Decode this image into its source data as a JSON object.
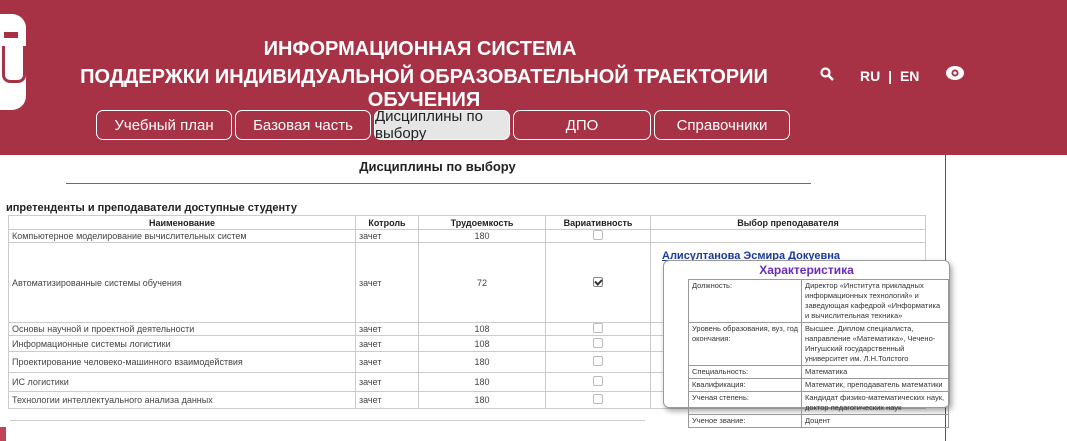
{
  "header": {
    "title_line1": "ИНФОРМАЦИОННАЯ СИСТЕМА",
    "title_line2": "ПОДДЕРЖКИ ИНДИВИДУАЛЬНОЙ ОБРАЗОВАТЕЛЬНОЙ ТРАЕКТОРИИ ОБУЧЕНИЯ",
    "lang_ru": "RU",
    "lang_sep": "|",
    "lang_en": "EN",
    "icons": [
      "university-logo-icon",
      "search-icon",
      "eye-icon"
    ],
    "bg_color": "#a83245"
  },
  "nav": [
    {
      "label": "Учебный план"
    },
    {
      "label": "Базовая часть"
    },
    {
      "label": "Дисциплины по выбору",
      "active": true
    },
    {
      "label": "ДПО"
    },
    {
      "label": "Справочники"
    }
  ],
  "page": {
    "title": "Дисциплины по выбору",
    "subtitle": "ипретенденты и преподаватели доступные студенту"
  },
  "table": {
    "headers": [
      "Наименование",
      "Котроль",
      "Трудоемкость",
      "Вариативность",
      "Выбор преподавателя"
    ],
    "rows": [
      {
        "name": "Компьютерное моделирование вычислительных систем",
        "control": "зачет",
        "hours": "180",
        "checked": false
      },
      {
        "name": "Автоматизированные системы обучения",
        "control": "зачет",
        "hours": "72",
        "checked": true
      },
      {
        "name": "Основы научной и проектной деятельности",
        "control": "зачет",
        "hours": "108",
        "checked": false
      },
      {
        "name": "Информационные системы логистики",
        "control": "зачет",
        "hours": "108",
        "checked": false
      },
      {
        "name": "Проектирование человеко-машинного взаимодействия",
        "control": "зачет",
        "hours": "180",
        "checked": false
      },
      {
        "name": "ИС логистики",
        "control": "зачет",
        "hours": "180",
        "checked": false
      },
      {
        "name": "Технологии интеллектуального анализа данных",
        "control": "зачет",
        "hours": "180",
        "checked": false
      }
    ]
  },
  "teacher": {
    "name": "Алисултанова Эсмира Докуевна",
    "popup_title": "Характеристика",
    "info": [
      {
        "label": "Должность:",
        "value": "Директор «Института прикладных информационных технологий» и заведующая кафедрой «Информатика и вычислительная техника»"
      },
      {
        "label": "Уровень образования, вуз, год окончания:",
        "value": "Высшее. Диплом специалиста, направление «Математика», Чечено-Ингушский государственный университет им. Л.Н.Толстого"
      },
      {
        "label": "Специальность:",
        "value": "Математика"
      },
      {
        "label": "Квалификация:",
        "value": "Математик, преподаватель математики"
      },
      {
        "label": "Ученая степень:",
        "value": "Кандидат физико-математических наук, доктор педагогических наук"
      },
      {
        "label": "Ученое звание:",
        "value": "Доцент"
      }
    ]
  }
}
